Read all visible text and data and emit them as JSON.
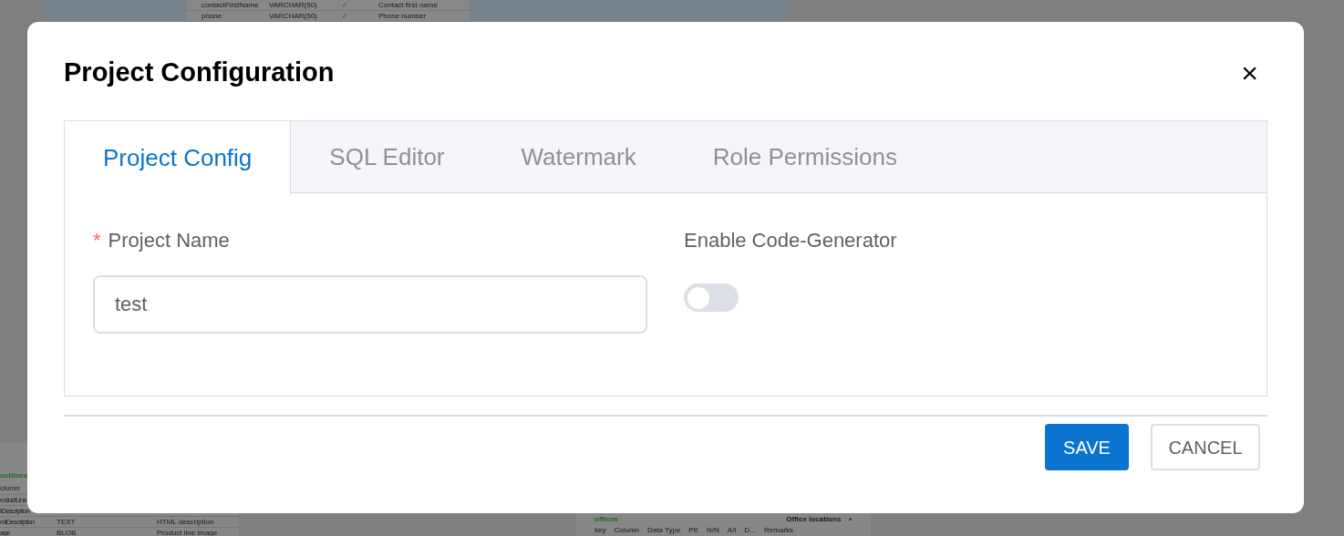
{
  "background": {
    "top_table": {
      "rows": [
        {
          "column": "contactFirstName",
          "type": "VARCHAR(50)",
          "check": "✓",
          "remarks": "Contact first name"
        },
        {
          "column": "phone",
          "type": "VARCHAR(50)",
          "check": "✓",
          "remarks": "Phone number"
        }
      ]
    },
    "left_table": {
      "title": "uctlines",
      "header": "olumn",
      "rows": [
        {
          "column": "roductLine",
          "type": "",
          "remarks": ""
        },
        {
          "column": "tDescription",
          "type": "",
          "remarks": ""
        },
        {
          "column": "mlDescription",
          "type": "TEXT",
          "remarks": "HTML description"
        },
        {
          "column": "age",
          "type": "BLOB",
          "remarks": "Product line image"
        }
      ]
    },
    "offices_table": {
      "title": "offices",
      "comment": "Office locations",
      "close": "×",
      "columns": [
        "key",
        "Column",
        "Data Type",
        "PK",
        "N/N",
        "A/I",
        "D...",
        "Remarks"
      ]
    }
  },
  "dialog": {
    "title": "Project Configuration",
    "close": "×",
    "tabs": [
      {
        "label": "Project Config",
        "selected": true
      },
      {
        "label": "SQL Editor",
        "selected": false
      },
      {
        "label": "Watermark",
        "selected": false
      },
      {
        "label": "Role Permissions",
        "selected": false
      }
    ],
    "fields": [
      {
        "kind": "text",
        "label": "Project Name",
        "required": true,
        "required_mark": "*",
        "value": "test"
      },
      {
        "kind": "switch",
        "label": "Enable Code-Generator",
        "required": false,
        "on": false
      }
    ],
    "buttons": [
      {
        "label": "SAVE",
        "kind": "primary"
      },
      {
        "label": "CANCEL",
        "kind": "secondary"
      }
    ]
  }
}
